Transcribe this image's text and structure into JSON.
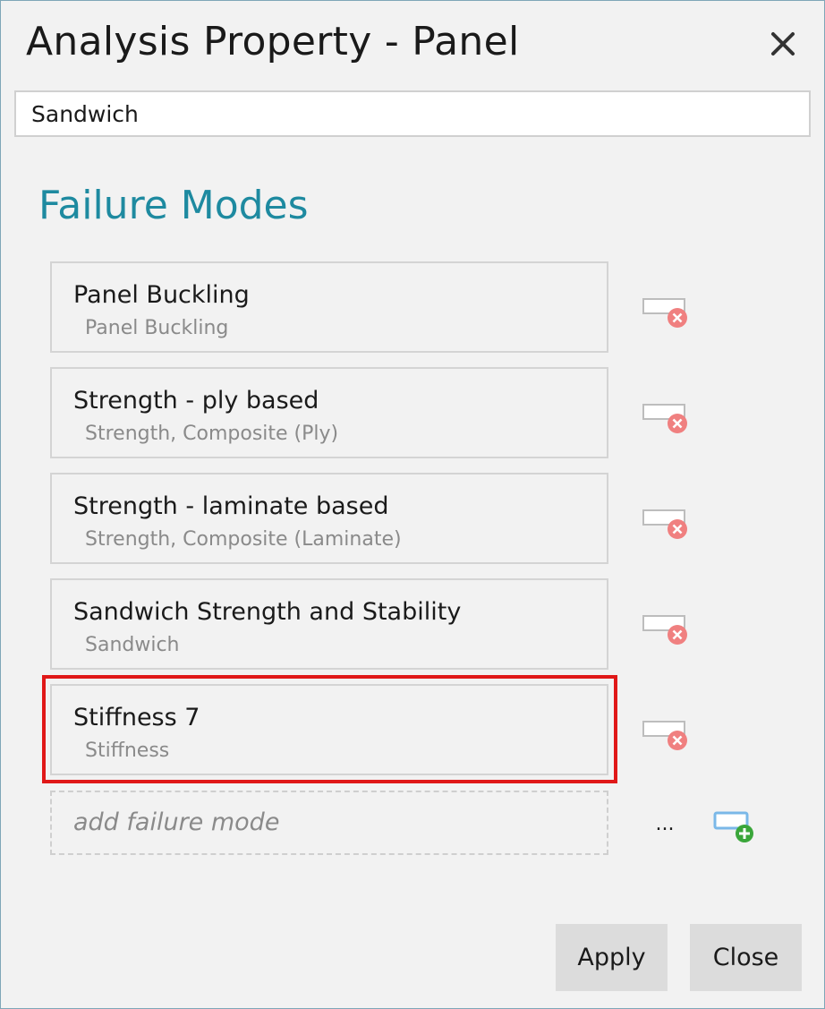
{
  "dialog": {
    "title": "Analysis Property - Panel",
    "close_icon": "close-icon"
  },
  "property_name": {
    "value": "Sandwich"
  },
  "failure_modes": {
    "heading": "Failure Modes",
    "items": [
      {
        "title": "Panel Buckling",
        "subtitle": "Panel Buckling"
      },
      {
        "title": "Strength - ply based",
        "subtitle": "Strength, Composite (Ply)"
      },
      {
        "title": "Strength - laminate based",
        "subtitle": "Strength, Composite (Laminate)"
      },
      {
        "title": "Sandwich Strength and Stability",
        "subtitle": "Sandwich"
      },
      {
        "title": "Stiffness 7",
        "subtitle": "Stiffness",
        "highlighted": true
      }
    ],
    "remove_icon": "remove-item-icon",
    "add_placeholder": "add failure mode",
    "ellipsis_label": "...",
    "add_icon": "add-item-icon"
  },
  "footer": {
    "apply_label": "Apply",
    "close_label": "Close"
  },
  "colors": {
    "accent": "#1e8aa0",
    "highlight_border": "#e01818",
    "remove_badge": "#f08080",
    "add_badge": "#3aa63a",
    "add_frame": "#7ab8e8"
  }
}
